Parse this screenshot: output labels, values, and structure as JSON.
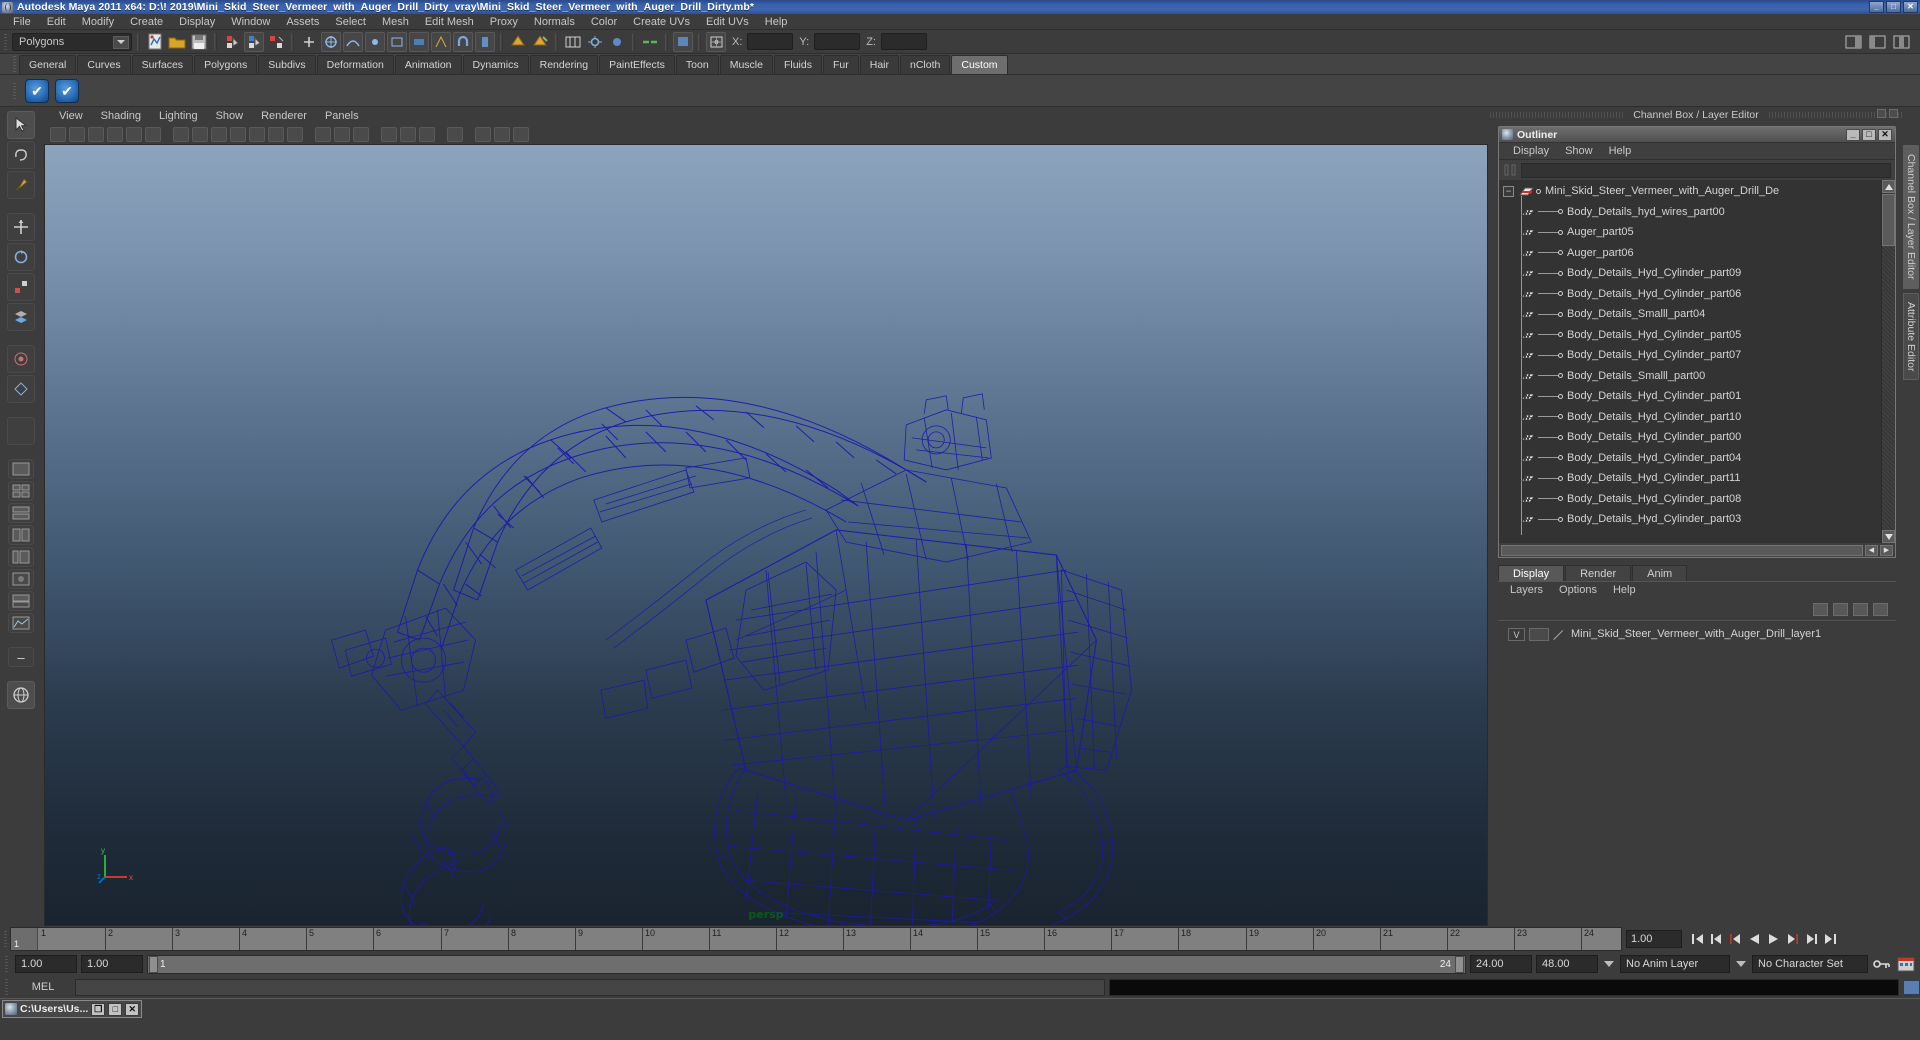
{
  "window": {
    "title": "Autodesk Maya 2011 x64: D:\\! 2019\\Mini_Skid_Steer_Vermeer_with_Auger_Drill_Dirty_vray\\Mini_Skid_Steer_Vermeer_with_Auger_Drill_Dirty.mb*",
    "minimize": "_",
    "maximize": "□",
    "close": "✕"
  },
  "menubar": {
    "items": [
      "File",
      "Edit",
      "Modify",
      "Create",
      "Display",
      "Window",
      "Assets",
      "Select",
      "Mesh",
      "Edit Mesh",
      "Proxy",
      "Normals",
      "Color",
      "Create UVs",
      "Edit UVs",
      "Help"
    ]
  },
  "statusbar": {
    "mode_selector": "Polygons",
    "x_label": "X:",
    "y_label": "Y:",
    "z_label": "Z:",
    "x_value": "",
    "y_value": "",
    "z_value": ""
  },
  "shelf": {
    "tabs": [
      "General",
      "Curves",
      "Surfaces",
      "Polygons",
      "Subdivs",
      "Deformation",
      "Animation",
      "Dynamics",
      "Rendering",
      "PaintEffects",
      "Toon",
      "Muscle",
      "Fluids",
      "Fur",
      "Hair",
      "nCloth",
      "Custom"
    ],
    "active_tab": "Custom",
    "buttons": [
      "check-icon",
      "check-icon"
    ]
  },
  "viewport": {
    "menus": [
      "View",
      "Shading",
      "Lighting",
      "Show",
      "Renderer",
      "Panels"
    ],
    "camera_label": "persp",
    "axis_x": "x",
    "axis_y": "y",
    "axis_z": "z",
    "wireframe_color": "#1a18a8",
    "bg_top": "#8ca4bd",
    "bg_bottom": "#1a2430"
  },
  "channelbox": {
    "header": "Channel Box / Layer Editor"
  },
  "outliner": {
    "title": "Outliner",
    "menus": [
      "Display",
      "Show",
      "Help"
    ],
    "search_value": "",
    "window_buttons": [
      "_",
      "□",
      "✕"
    ],
    "root": "Mini_Skid_Steer_Vermeer_with_Auger_Drill_De",
    "items": [
      "Body_Details_hyd_wires_part00",
      "Auger_part05",
      "Auger_part06",
      "Body_Details_Hyd_Cylinder_part09",
      "Body_Details_Hyd_Cylinder_part06",
      "Body_Details_Smalll_part04",
      "Body_Details_Hyd_Cylinder_part05",
      "Body_Details_Hyd_Cylinder_part07",
      "Body_Details_Smalll_part00",
      "Body_Details_Hyd_Cylinder_part01",
      "Body_Details_Hyd_Cylinder_part10",
      "Body_Details_Hyd_Cylinder_part00",
      "Body_Details_Hyd_Cylinder_part04",
      "Body_Details_Hyd_Cylinder_part11",
      "Body_Details_Hyd_Cylinder_part08",
      "Body_Details_Hyd_Cylinder_part03"
    ]
  },
  "layer_editor": {
    "tabs": [
      "Display",
      "Render",
      "Anim"
    ],
    "active_tab": "Display",
    "menus": [
      "Layers",
      "Options",
      "Help"
    ],
    "layers": [
      {
        "visibility": "V",
        "shading": "",
        "name": "Mini_Skid_Steer_Vermeer_with_Auger_Drill_layer1"
      }
    ]
  },
  "side_tabs": {
    "items": [
      "Channel Box / Layer Editor",
      "Attribute Editor"
    ],
    "active": "Channel Box / Layer Editor"
  },
  "timeline": {
    "start": 1,
    "end": 24,
    "current_frame": "1",
    "ticks": [
      "1",
      "2",
      "3",
      "4",
      "5",
      "6",
      "7",
      "8",
      "9",
      "10",
      "11",
      "12",
      "13",
      "14",
      "15",
      "16",
      "17",
      "18",
      "19",
      "20",
      "21",
      "22",
      "23",
      "24"
    ],
    "frame_field": "1.00",
    "playback_buttons": [
      "go-to-start",
      "step-back-key",
      "step-back-frame",
      "play-backwards",
      "play-forwards",
      "step-forward-frame",
      "step-forward-key",
      "go-to-end"
    ]
  },
  "range_slider": {
    "anim_start": "1.00",
    "anim_end": "1.00",
    "range_start": "1",
    "range_end": "24",
    "playback_start": "24.00",
    "playback_end": "48.00",
    "anim_layer": "No Anim Layer",
    "character_set": "No Character Set"
  },
  "command_line": {
    "language": "MEL",
    "input_value": "",
    "output_value": ""
  },
  "taskbar": {
    "item_title": "C:\\Users\\Us...",
    "buttons": [
      "❐",
      "□",
      "✕"
    ]
  }
}
